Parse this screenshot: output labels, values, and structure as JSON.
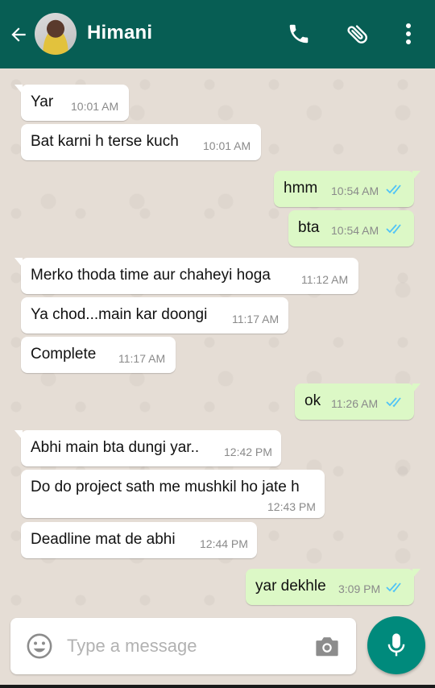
{
  "contact": {
    "name": "Himani"
  },
  "composer": {
    "placeholder": "Type a message"
  },
  "messages": [
    {
      "dir": "in",
      "text": "Yar",
      "time": "10:01 AM"
    },
    {
      "dir": "in",
      "text": "Bat karni h terse kuch",
      "time": "10:01 AM"
    },
    {
      "dir": "out",
      "text": "hmm",
      "time": "10:54 AM",
      "read": true
    },
    {
      "dir": "out",
      "text": "bta",
      "time": "10:54 AM",
      "read": true
    },
    {
      "dir": "in",
      "text": "Merko thoda time aur chaheyi hoga",
      "time": "11:12 AM"
    },
    {
      "dir": "in",
      "text": "Ya chod...main kar doongi",
      "time": "11:17 AM"
    },
    {
      "dir": "in",
      "text": "Complete",
      "time": "11:17 AM"
    },
    {
      "dir": "out",
      "text": "ok",
      "time": "11:26 AM",
      "read": true
    },
    {
      "dir": "in",
      "text": "Abhi main bta dungi yar..",
      "time": "12:42 PM"
    },
    {
      "dir": "in",
      "text": "Do do project sath me mushkil ho jate h",
      "time": "12:43 PM"
    },
    {
      "dir": "in",
      "text": "Deadline mat de abhi",
      "time": "12:44 PM"
    },
    {
      "dir": "out",
      "text": "yar dekhle",
      "time": "3:09 PM",
      "read": true
    }
  ],
  "colors": {
    "header": "#075e54",
    "incoming_bubble": "#ffffff",
    "outgoing_bubble": "#dcf8c6",
    "read_ticks": "#4fc3f7",
    "mic_button": "#008a7c"
  },
  "icons": {
    "back": "arrow-left-icon",
    "call": "phone-icon",
    "attach": "paperclip-icon",
    "menu": "more-vertical-icon",
    "emoji": "smiley-icon",
    "camera": "camera-icon",
    "mic": "microphone-icon"
  }
}
